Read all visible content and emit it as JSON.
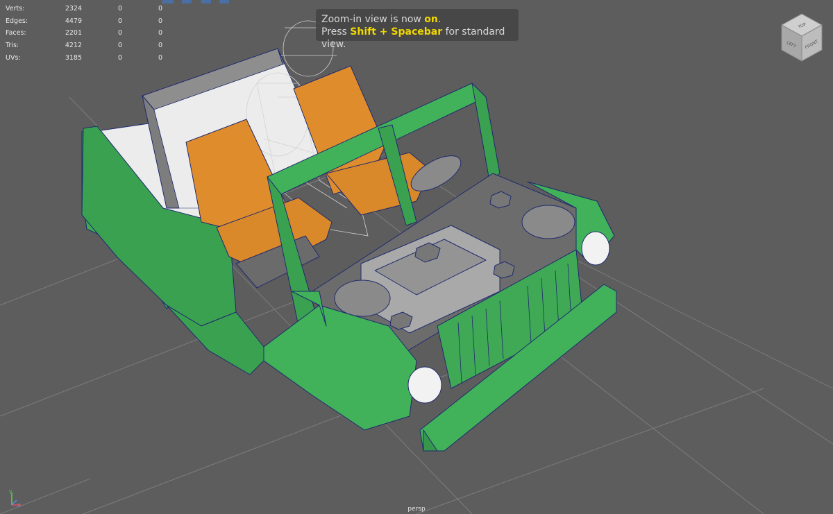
{
  "stats": [
    {
      "label": "Verts:",
      "values": [
        "2324",
        "0",
        "0"
      ]
    },
    {
      "label": "Edges:",
      "values": [
        "4479",
        "0",
        "0"
      ]
    },
    {
      "label": "Faces:",
      "values": [
        "2201",
        "0",
        "0"
      ]
    },
    {
      "label": "Tris:",
      "values": [
        "4212",
        "0",
        "0"
      ]
    },
    {
      "label": "UVs:",
      "values": [
        "3185",
        "0",
        "0"
      ]
    }
  ],
  "message": {
    "part1": "Zoom-in view is now ",
    "on": "on",
    "part2": ".",
    "press": "Press ",
    "keys": "Shift + Spacebar",
    "tail": " for standard view."
  },
  "viewcube": {
    "top": "TOP",
    "left": "LEFT",
    "front": "FRONT"
  },
  "camera_label": "persp",
  "axis_labels": {
    "y": "Y",
    "z": "Z"
  },
  "colors": {
    "viewport_bg": "#5d5d5d",
    "body_green": "#41b15a",
    "seat_orange": "#df8c2c",
    "highlight_yellow": "#f0d800",
    "wire_blue": "#1f2a6e"
  }
}
